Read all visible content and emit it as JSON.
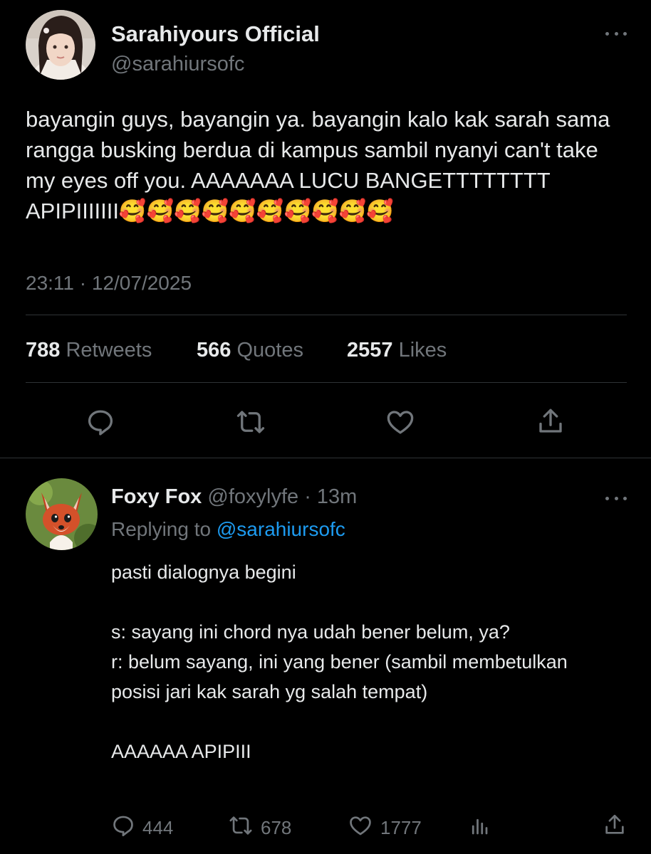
{
  "main_tweet": {
    "display_name": "Sarahiyours Official",
    "handle": "@sarahiursofc",
    "text": "bayangin guys, bayangin ya. bayangin kalo kak sarah sama rangga busking berdua di kampus sambil nyanyi can't take my eyes off you. AAAAAAA LUCU BANGETTTTTTTT APIPIIIIIII🥰🥰🥰🥰🥰🥰🥰🥰🥰🥰",
    "timestamp": "23:11 · 12/07/2025",
    "stats": {
      "retweets_count": "788",
      "retweets_label": "Retweets",
      "quotes_count": "566",
      "quotes_label": "Quotes",
      "likes_count": "2557",
      "likes_label": "Likes"
    }
  },
  "reply": {
    "display_name": "Foxy Fox",
    "handle": "@foxylyfe",
    "time": "· 13m",
    "replying_label": "Replying to",
    "replying_handle": "@sarahiursofc",
    "text": "pasti dialognya begini\n\ns: sayang ini chord nya udah bener belum, ya?\nr: belum sayang, ini yang bener (sambil membetulkan posisi jari kak sarah yg salah tempat)\n\nAAAAAA APIPIII",
    "actions": {
      "replies": "444",
      "retweets": "678",
      "likes": "1777"
    }
  },
  "icons": [
    "more-icon",
    "reply-icon",
    "retweet-icon",
    "like-icon",
    "share-icon",
    "views-icon"
  ],
  "colors": {
    "background": "#000000",
    "text": "#e7e9ea",
    "muted": "#71767b",
    "link": "#1d9bf0",
    "divider": "#2f3336"
  }
}
